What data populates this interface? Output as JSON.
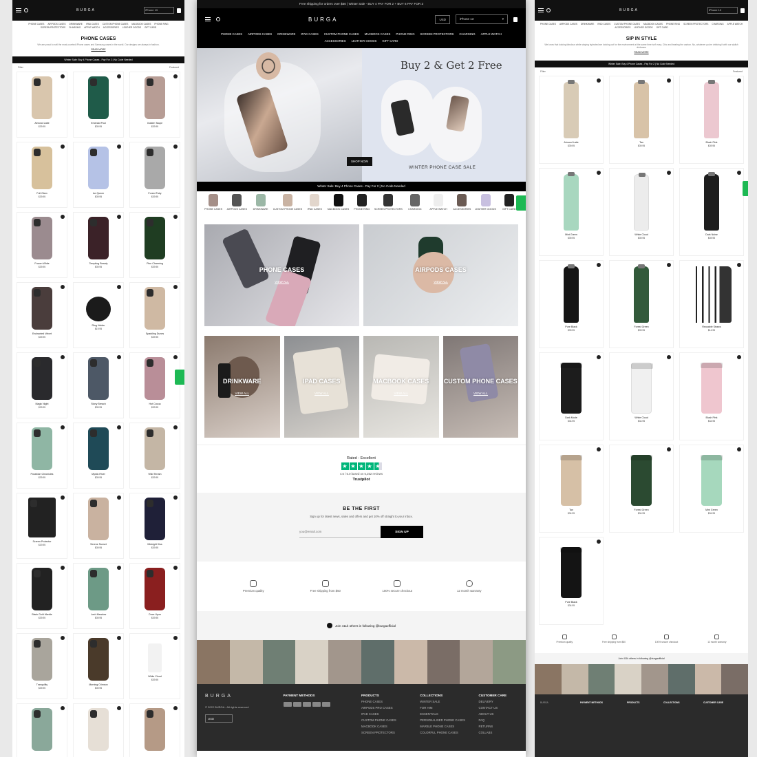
{
  "left": {
    "logo": "BURGA",
    "device": "iPhone 13",
    "nav": [
      "PHONE CASES",
      "AIRPODS CASES",
      "DRINKWARE",
      "IPAD CASES",
      "CUSTOM PHONE CASES",
      "MACBOOK CASES",
      "PHONE RING",
      "SCREEN PROTECTORS",
      "CHARGING",
      "APPLE WATCH",
      "ACCESSORIES",
      "LEATHER GOODS",
      "GIFT CARD"
    ],
    "title": "PHONE CASES",
    "description": "We are proud to sell the most-coveted iPhone cases and Samsung cases in the world. Our designs are always in fashion.",
    "read_more": "READ MORE",
    "banner": "Winter Sale: Buy 4 Phone Cases - Pay For 2 | No Code Needed",
    "filter": "Filter",
    "sort": "Featured",
    "products": [
      {
        "name": "Almond Latte",
        "price": "$39.95",
        "color": "#d9c6ad"
      },
      {
        "name": "Emerald Pool",
        "price": "$39.95",
        "color": "#1f5b49"
      },
      {
        "name": "Golden Taupe",
        "price": "$39.95",
        "color": "#b79d95"
      },
      {
        "name": "Full Glam",
        "price": "$39.95",
        "color": "#d7c19c"
      },
      {
        "name": "Ice Queen",
        "price": "$39.95",
        "color": "#b5c2e6"
      },
      {
        "name": "Forest Fairy",
        "price": "$39.95",
        "color": "#a9a9a9"
      },
      {
        "name": "Frozen White",
        "price": "$39.95",
        "color": "#9b8b8f"
      },
      {
        "name": "Tempting Beauty",
        "price": "$39.95",
        "color": "#3b2228"
      },
      {
        "name": "Pine Charming",
        "price": "$39.95",
        "color": "#1f3d22"
      },
      {
        "name": "Enchanted Velvet",
        "price": "$39.95",
        "color": "#4a3d3c"
      },
      {
        "name": "Ring Holder",
        "price": "$19.95",
        "color": "#1b1b1b"
      },
      {
        "name": "Sparkling Dunes",
        "price": "$39.95",
        "color": "#cfb9a3"
      },
      {
        "name": "Magic Night",
        "price": "$39.95",
        "color": "#2a2a2d"
      },
      {
        "name": "Stony Breach",
        "price": "$39.95",
        "color": "#4d5866"
      },
      {
        "name": "Hot Cocoa",
        "price": "$39.95",
        "color": "#b98e98"
      },
      {
        "name": "Poseidon Chronicles",
        "price": "$39.95",
        "color": "#8fb6a4"
      },
      {
        "name": "Mystic River",
        "price": "$39.95",
        "color": "#1f4a57"
      },
      {
        "name": "Wild Terrain",
        "price": "$39.95",
        "color": "#c4b6a5"
      },
      {
        "name": "Screen Protector",
        "price": "$19.95",
        "color": "#222"
      },
      {
        "name": "Serene Sunset",
        "price": "$39.95",
        "color": "#c9b2a0"
      },
      {
        "name": "Midnight Kiss",
        "price": "$39.95",
        "color": "#1f2038"
      },
      {
        "name": "Black Gold Marble",
        "price": "$39.95",
        "color": "#222"
      },
      {
        "name": "Lush Meadow",
        "price": "$39.95",
        "color": "#6d9a86"
      },
      {
        "name": "Once Upon",
        "price": "$39.95",
        "color": "#8a1f1f"
      },
      {
        "name": "Tranquility",
        "price": "$39.95",
        "color": "#a9a59c"
      },
      {
        "name": "Morning Crimson",
        "price": "$39.95",
        "color": "#4a3a2a"
      },
      {
        "name": "White Cloud",
        "price": "$39.95",
        "color": "#f2f2f2"
      },
      {
        "name": "",
        "price": "",
        "color": "#8aa89a"
      },
      {
        "name": "",
        "price": "",
        "color": "#e6dfd6"
      },
      {
        "name": "",
        "price": "",
        "color": "#b59a86"
      }
    ]
  },
  "center": {
    "shipping_bar": "Free shipping for orders over $50 | Winter Sale - BUY 4 PAY FOR 2 + BUY 6 PAY FOR 3",
    "logo": "BURGA",
    "currency": "USD",
    "device": "iPhone 13",
    "nav": [
      "PHONE CASES",
      "AIRPODS CASES",
      "DRINKWARE",
      "IPAD CASES",
      "CUSTOM PHONE CASES",
      "MACBOOK CASES",
      "PHONE RING",
      "SCREEN PROTECTORS",
      "CHARGING",
      "APPLE WATCH",
      "ACCESSORIES",
      "LEATHER GOODS",
      "GIFT CARD"
    ],
    "hero": {
      "headline": "Buy 2 & Get 2 Free",
      "subtitle": "WINTER PHONE CASE SALE",
      "cta": "SHOP NOW"
    },
    "winter_bar": "Winter Sale: Buy 4 Phone Cases - Pay For 2 | No Code Needed",
    "categories": [
      "PHONE CASES",
      "AIRPODS CASES",
      "DRINKWARE",
      "CUSTOM PHONE CASES",
      "IPAD CASES",
      "MACBOOK CASES",
      "PHONE RING",
      "SCREEN PROTECTORS",
      "CHARGING",
      "APPLE WATCH",
      "ACCESSORIES",
      "LEATHER GOODS",
      "GIFT CARD"
    ],
    "tiles_top": [
      {
        "title": "PHONE CASES",
        "cta": "VIEW ALL"
      },
      {
        "title": "AIRPODS CASES",
        "cta": "VIEW ALL"
      }
    ],
    "tiles_bottom": [
      {
        "title": "DRINKWARE",
        "cta": "VIEW ALL"
      },
      {
        "title": "IPAD CASES",
        "cta": "VIEW ALL"
      },
      {
        "title": "MACBOOK CASES",
        "cta": "VIEW ALL"
      },
      {
        "title": "CUSTOM PHONE CASES",
        "cta": "VIEW ALL"
      }
    ],
    "trust": {
      "rated": "Rated - Excellent",
      "score": "4.6 / 5.0 based on 5,252 reviews",
      "brand": "Trustpilot"
    },
    "newsletter": {
      "title": "BE THE FIRST",
      "text": "Sign up for latest news, sales and offers and get 10% off straight to your inbox.",
      "placeholder": "you@email.com",
      "button": "SIGN UP"
    },
    "perks": [
      "Premium quality",
      "Free shipping from $50",
      "100% secure checkout",
      "12 month warranty"
    ],
    "instagram": "Join 411k others in following @burgaofficial",
    "footer": {
      "copyright": "© 2022 BURGA - All rights reserved",
      "currency": "USD",
      "payment_title": "PAYMENT METHODS",
      "products": {
        "title": "PRODUCTS",
        "items": [
          "PHONE CASES",
          "AIRPODS PRO CASES",
          "IPAD CASES",
          "CUSTOM PHONE CASES",
          "MACBOOK CASES",
          "SCREEN PROTECTORS"
        ]
      },
      "collections": {
        "title": "COLLECTIONS",
        "items": [
          "WINTER SALE",
          "FOR HIM",
          "ESSENTIALS",
          "PERSONALISED PHONE CASES",
          "MARBLE PHONE CASES",
          "COLORFUL PHONE CASES"
        ]
      },
      "care": {
        "title": "CUSTOMER CARE",
        "items": [
          "DELIVERY",
          "CONTACT US",
          "ABOUT US",
          "FAQ",
          "RETURNS",
          "COLLABS"
        ]
      }
    }
  },
  "right": {
    "logo": "BURGA",
    "device": "iPhone 13",
    "title": "SIP IN STYLE",
    "description": "We know that looking fabulous while staying hydrated are looking out for the environment at the same time isn't easy. Chic and beating the carbon. No, whatever you're drinking it with our stylish drinkware",
    "read_more": "READ MORE",
    "banner": "Winter Sale: Buy 4 Phone Cases - Pay For 2 | No Code Needed",
    "filter": "Filter",
    "sort": "Featured",
    "products": [
      {
        "name": "Almond Latte",
        "price": "$39.95",
        "color": "#d8cbb6",
        "kind": "bottle"
      },
      {
        "name": "Tan",
        "price": "$39.95",
        "color": "#d8c3a8",
        "kind": "bottle"
      },
      {
        "name": "Blush Pink",
        "price": "$39.95",
        "color": "#ecc8d0",
        "kind": "bottle"
      },
      {
        "name": "Mint Green",
        "price": "$39.95",
        "color": "#a8d7bf",
        "kind": "bottle"
      },
      {
        "name": "White Cloud",
        "price": "$39.95",
        "color": "#ececec",
        "kind": "bottle"
      },
      {
        "name": "Dark Noise",
        "price": "$39.95",
        "color": "#1e1e1e",
        "kind": "bottle"
      },
      {
        "name": "Pure Black",
        "price": "$39.95",
        "color": "#151515",
        "kind": "bottle"
      },
      {
        "name": "Forest Green",
        "price": "$39.95",
        "color": "#335a3b",
        "kind": "bottle"
      },
      {
        "name": "Reusable Straws",
        "price": "$14.95",
        "color": "#222",
        "kind": "straws"
      },
      {
        "name": "Dark Mode",
        "price": "$34.95",
        "color": "#1c1c1c",
        "kind": "tumbler"
      },
      {
        "name": "White Cloud",
        "price": "$34.95",
        "color": "#f0f0f0",
        "kind": "tumbler"
      },
      {
        "name": "Blush Pink",
        "price": "$34.95",
        "color": "#efc6cf",
        "kind": "tumbler"
      },
      {
        "name": "Tan",
        "price": "$34.95",
        "color": "#d6c0a6",
        "kind": "tumbler"
      },
      {
        "name": "Forest Green",
        "price": "$34.95",
        "color": "#2b4a31",
        "kind": "tumbler"
      },
      {
        "name": "Mint Green",
        "price": "$34.95",
        "color": "#a6d8bd",
        "kind": "tumbler"
      },
      {
        "name": "Pure Black",
        "price": "$34.95",
        "color": "#141414",
        "kind": "tumbler"
      }
    ],
    "perks": [
      "Premium quality",
      "Free shipping from $50",
      "100% secure checkout",
      "12 month warranty"
    ],
    "instagram": "Join 411k others in following @burgaofficial",
    "footer": {
      "payment": "PAYMENT METHODS",
      "products": "PRODUCTS",
      "collections": "COLLECTIONS",
      "care": "CUSTOMER CARE",
      "currency": "USD"
    }
  }
}
